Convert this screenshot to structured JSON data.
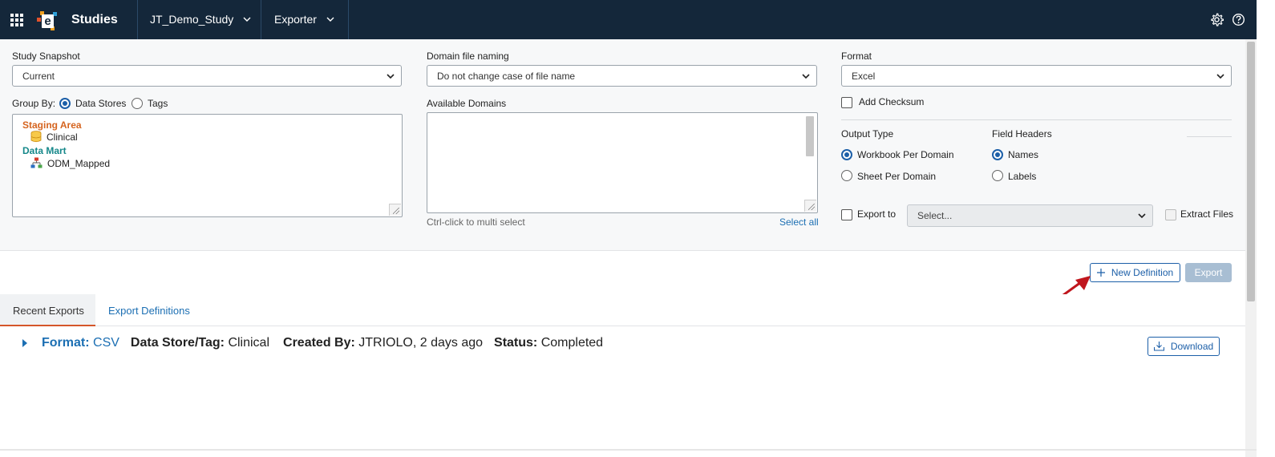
{
  "nav": {
    "app_title": "Studies",
    "study": "JT_Demo_Study",
    "module": "Exporter"
  },
  "config": {
    "study_snapshot": {
      "label": "Study Snapshot",
      "value": "Current"
    },
    "group_by": {
      "label": "Group By:",
      "options": [
        "Data Stores",
        "Tags"
      ],
      "selected": "Data Stores"
    },
    "tree": {
      "groups": [
        {
          "name": "Staging Area",
          "color": "#d5641f",
          "items": [
            "Clinical"
          ]
        },
        {
          "name": "Data Mart",
          "color": "#16888a",
          "items": [
            "ODM_Mapped"
          ]
        }
      ]
    },
    "domain_file_naming": {
      "label": "Domain file naming",
      "value": "Do not change case of file name"
    },
    "available_domains": {
      "label": "Available Domains",
      "hint": "Ctrl-click to multi select",
      "select_all": "Select all"
    },
    "format": {
      "label": "Format",
      "value": "Excel"
    },
    "add_checksum": {
      "label": "Add Checksum",
      "checked": false
    },
    "output_type": {
      "label": "Output Type",
      "options": [
        "Workbook Per Domain",
        "Sheet Per Domain"
      ],
      "selected": "Workbook Per Domain"
    },
    "field_headers": {
      "label": "Field Headers",
      "options": [
        "Names",
        "Labels"
      ],
      "selected": "Names"
    },
    "export_to": {
      "label": "Export to",
      "checked": false,
      "placeholder": "Select..."
    },
    "extract_files": {
      "label": "Extract Files",
      "checked": false
    }
  },
  "actions": {
    "new_definition": "New Definition",
    "export": "Export"
  },
  "tabs": [
    {
      "label": "Recent Exports",
      "active": true
    },
    {
      "label": "Export Definitions",
      "active": false
    }
  ],
  "recent_exports": [
    {
      "format_label": "Format:",
      "format": "CSV",
      "store_label": "Data Store/Tag:",
      "store": "Clinical",
      "created_label": "Created By:",
      "created": "JTRIOLO, 2 days ago",
      "status_label": "Status:",
      "status": "Completed",
      "download": "Download"
    }
  ]
}
